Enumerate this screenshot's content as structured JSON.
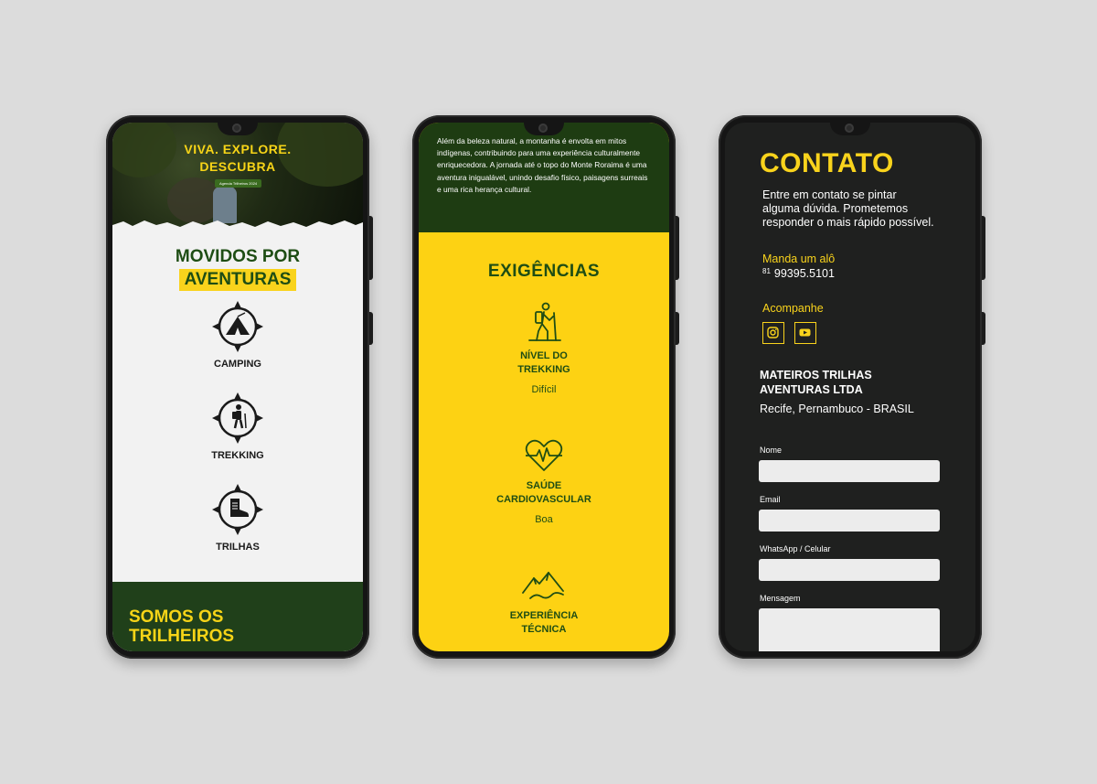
{
  "phone1": {
    "hero_title_line1": "VIVA. EXPLORE.",
    "hero_title_line2": "DESCUBRA",
    "hero_badge": "Agenda Trilheiros 2024",
    "heading_line1": "MOVIDOS POR",
    "heading_highlight": "AVENTURAS",
    "activities": [
      {
        "label": "CAMPING",
        "icon": "tent-icon"
      },
      {
        "label": "TREKKING",
        "icon": "hiker-icon"
      },
      {
        "label": "TRILHAS",
        "icon": "boot-icon"
      }
    ],
    "footer_line1": "SOMOS OS",
    "footer_line2": "TRILHEIROS",
    "colors": {
      "green": "#1e4d14",
      "yellow": "#f9d31c",
      "background": "#f2f2f2"
    }
  },
  "phone2": {
    "intro_text": "Além da beleza natural, a montanha é envolta em mitos indígenas, contribuindo para uma experiência culturalmente enriquecedora. A jornada até o topo do Monte Roraima é uma aventura inigualável, unindo desafio físico, paisagens surreais e uma rica herança cultural.",
    "heading": "EXIGÊNCIAS",
    "requirements": [
      {
        "line1": "NÍVEL DO",
        "line2": "TREKKING",
        "value": "Difícil",
        "icon": "hiker-icon"
      },
      {
        "line1": "SAÚDE",
        "line2": "CARDIOVASCULAR",
        "value": "Boa",
        "icon": "heartbeat-icon"
      },
      {
        "line1": "EXPERIÊNCIA",
        "line2": "TÉCNICA",
        "value": "",
        "icon": "mountain-icon"
      }
    ],
    "colors": {
      "yellow": "#fdd213",
      "green": "#1e3c12"
    }
  },
  "phone3": {
    "title": "CONTATO",
    "description": "Entre em contato se pintar alguma dúvida. Prometemos responder o mais rápido possível.",
    "call_label": "Manda um alô",
    "phone_ddd": "81",
    "phone_number": "99395.5101",
    "follow_label": "Acompanhe",
    "social": [
      {
        "icon": "instagram-icon"
      },
      {
        "icon": "youtube-icon"
      }
    ],
    "company_line1": "MATEIROS  TRILHAS",
    "company_line2": "AVENTURAS LTDA",
    "location": "Recife, Pernambuco - BRASIL",
    "form": {
      "name_label": "Nome",
      "email_label": "Email",
      "whatsapp_label": "WhatsApp / Celular",
      "message_label": "Mensagem"
    },
    "colors": {
      "background": "#1f201f",
      "yellow": "#f9d31c"
    }
  }
}
